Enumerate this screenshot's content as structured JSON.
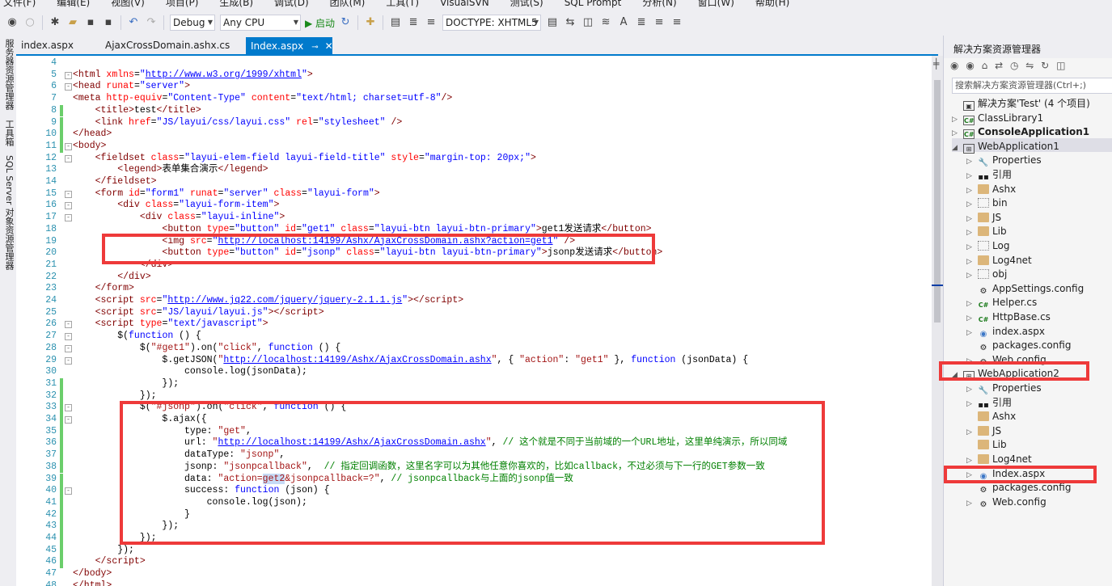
{
  "menu": [
    "文件(F)",
    "编辑(E)",
    "视图(V)",
    "项目(P)",
    "生成(B)",
    "调试(D)",
    "团队(M)",
    "工具(T)",
    "VisualSVN",
    "测试(S)",
    "SQL Prompt",
    "分析(N)",
    "窗口(W)",
    "帮助(H)"
  ],
  "toolbar": {
    "config": "Debug",
    "platform": "Any CPU",
    "start_label": "▶ 启动",
    "doctype": "DOCTYPE: XHTML5"
  },
  "left_tabs": [
    "服务器资源管理器",
    "工具箱",
    "SQL Server 对象资源管理器"
  ],
  "tabs": [
    {
      "label": "index.aspx"
    },
    {
      "label": "AjaxCrossDomain.ashx.cs"
    },
    {
      "label": "Index.aspx",
      "active": true,
      "pin": "⊸",
      "close": "✕"
    }
  ],
  "code": [
    {
      "n": "4",
      "bar": "none",
      "fold": "",
      "html": ""
    },
    {
      "n": "5",
      "bar": "none",
      "fold": "-",
      "html": "<span class='tag'>&lt;html</span> <span class='attr'>xmlns</span><span class='plain'>=</span><span class='val'>\"</span><span class='link'>http://www.w3.org/1999/xhtml</span><span class='val'>\"</span><span class='tag'>&gt;</span>"
    },
    {
      "n": "6",
      "bar": "none",
      "fold": "-",
      "html": "<span class='tag'>&lt;head</span> <span class='attr'>runat</span><span class='plain'>=</span><span class='val'>\"server\"</span><span class='tag'>&gt;</span>"
    },
    {
      "n": "7",
      "bar": "none",
      "fold": "",
      "html": "<span class='tag'>&lt;meta</span> <span class='attr'>http-equiv</span><span class='plain'>=</span><span class='val'>\"Content-Type\"</span> <span class='attr'>content</span><span class='plain'>=</span><span class='val'>\"text/html; charset=utf-8\"</span><span class='tag'>/&gt;</span>"
    },
    {
      "n": "8",
      "bar": "green",
      "fold": "",
      "html": "    <span class='tag'>&lt;title&gt;</span><span class='plain'>test</span><span class='tag'>&lt;/title&gt;</span>"
    },
    {
      "n": "9",
      "bar": "green",
      "fold": "",
      "html": "    <span class='tag'>&lt;link</span> <span class='attr'>href</span><span class='plain'>=</span><span class='val'>\"JS/layui/css/layui.css\"</span> <span class='attr'>rel</span><span class='plain'>=</span><span class='val'>\"stylesheet\"</span> <span class='tag'>/&gt;</span>"
    },
    {
      "n": "10",
      "bar": "green",
      "fold": "",
      "html": "<span class='tag'>&lt;/head&gt;</span>"
    },
    {
      "n": "11",
      "bar": "green",
      "fold": "-",
      "html": "<span class='tag'>&lt;body&gt;</span>"
    },
    {
      "n": "12",
      "bar": "none",
      "fold": "-",
      "html": "    <span class='tag'>&lt;fieldset</span> <span class='attr'>class</span><span class='plain'>=</span><span class='val'>\"layui-elem-field layui-field-title\"</span> <span class='attr'>style</span><span class='plain'>=</span><span class='val'>\"margin-top: 20px;\"</span><span class='tag'>&gt;</span>"
    },
    {
      "n": "13",
      "bar": "none",
      "fold": "",
      "html": "        <span class='tag'>&lt;legend&gt;</span><span class='plain'>表单集合演示</span><span class='tag'>&lt;/legend&gt;</span>"
    },
    {
      "n": "14",
      "bar": "none",
      "fold": "",
      "html": "    <span class='tag'>&lt;/fieldset&gt;</span>"
    },
    {
      "n": "15",
      "bar": "none",
      "fold": "-",
      "html": "    <span class='tag'>&lt;form</span> <span class='attr'>id</span><span class='plain'>=</span><span class='val'>\"form1\"</span> <span class='attr'>runat</span><span class='plain'>=</span><span class='val'>\"server\"</span> <span class='attr'>class</span><span class='plain'>=</span><span class='val'>\"layui-form\"</span><span class='tag'>&gt;</span>"
    },
    {
      "n": "16",
      "bar": "none",
      "fold": "-",
      "html": "        <span class='tag'>&lt;div</span> <span class='attr'>class</span><span class='plain'>=</span><span class='val'>\"layui-form-item\"</span><span class='tag'>&gt;</span>"
    },
    {
      "n": "17",
      "bar": "none",
      "fold": "-",
      "html": "            <span class='tag'>&lt;div</span> <span class='attr'>class</span><span class='plain'>=</span><span class='val'>\"layui-inline\"</span><span class='tag'>&gt;</span>"
    },
    {
      "n": "18",
      "bar": "none",
      "fold": "",
      "html": "                <span class='tag'>&lt;button</span> <span class='attr'>type</span><span class='plain'>=</span><span class='val'>\"button\"</span> <span class='attr'>id</span><span class='plain'>=</span><span class='val'>\"get1\"</span> <span class='attr'>class</span><span class='plain'>=</span><span class='val'>\"layui-btn layui-btn-primary\"</span><span class='tag'>&gt;</span><span class='plain'>get1发送请求</span><span class='tag'>&lt;/button&gt;</span>"
    },
    {
      "n": "19",
      "bar": "none",
      "fold": "",
      "html": "                <span class='tag'>&lt;img</span> <span class='attr'>src</span><span class='plain'>=</span><span class='val'>\"</span><span class='link'>http://localhost:14199/Ashx/AjaxCrossDomain.ashx?action=get1</span><span class='val'>\"</span> <span class='tag'>/&gt;</span>"
    },
    {
      "n": "20",
      "bar": "none",
      "fold": "",
      "html": "                <span class='tag'>&lt;button</span> <span class='attr'>type</span><span class='plain'>=</span><span class='val'>\"button\"</span> <span class='attr'>id</span><span class='plain'>=</span><span class='val'>\"jsonp\"</span> <span class='attr'>class</span><span class='plain'>=</span><span class='val'>\"layui-btn layui-btn-primary\"</span><span class='tag'>&gt;</span><span class='plain'>jsonp发送请求</span><span class='tag'>&lt;/button&gt;</span>"
    },
    {
      "n": "21",
      "bar": "none",
      "fold": "",
      "html": "            <span class='tag'>&lt;/div&gt;</span>"
    },
    {
      "n": "22",
      "bar": "none",
      "fold": "",
      "html": "        <span class='tag'>&lt;/div&gt;</span>"
    },
    {
      "n": "23",
      "bar": "none",
      "fold": "",
      "html": "    <span class='tag'>&lt;/form&gt;</span>"
    },
    {
      "n": "24",
      "bar": "none",
      "fold": "",
      "html": "    <span class='tag'>&lt;script</span> <span class='attr'>src</span><span class='plain'>=</span><span class='val'>\"</span><span class='link'>http://www.jq22.com/jquery/jquery-2.1.1.js</span><span class='val'>\"</span><span class='tag'>&gt;&lt;/script&gt;</span>"
    },
    {
      "n": "25",
      "bar": "none",
      "fold": "",
      "html": "    <span class='tag'>&lt;script</span> <span class='attr'>src</span><span class='plain'>=</span><span class='val'>\"JS/layui/layui.js\"</span><span class='tag'>&gt;&lt;/script&gt;</span>"
    },
    {
      "n": "26",
      "bar": "none",
      "fold": "-",
      "html": "    <span class='tag'>&lt;script</span> <span class='attr'>type</span><span class='plain'>=</span><span class='val'>\"text/javascript\"</span><span class='tag'>&gt;</span>"
    },
    {
      "n": "27",
      "bar": "none",
      "fold": "-",
      "html": "        <span class='plain'>$(</span><span class='kw'>function</span><span class='plain'> () {</span>"
    },
    {
      "n": "28",
      "bar": "none",
      "fold": "-",
      "html": "            <span class='plain'>$(</span><span class='str'>\"#get1\"</span><span class='plain'>).on(</span><span class='str'>\"click\"</span><span class='plain'>, </span><span class='kw'>function</span><span class='plain'> () {</span>"
    },
    {
      "n": "29",
      "bar": "none",
      "fold": "-",
      "html": "                <span class='plain'>$.getJSON(</span><span class='str'>\"</span><span class='link'>http://localhost:14199/Ashx/AjaxCrossDomain.ashx</span><span class='str'>\"</span><span class='plain'>, { </span><span class='str'>\"action\"</span><span class='plain'>: </span><span class='str'>\"get1\"</span><span class='plain'> }, </span><span class='kw'>function</span><span class='plain'> (jsonData) {</span>"
    },
    {
      "n": "30",
      "bar": "none",
      "fold": "",
      "html": "                    <span class='plain'>console.log(jsonData);</span>"
    },
    {
      "n": "31",
      "bar": "green",
      "fold": "",
      "html": "                <span class='plain'>});</span>"
    },
    {
      "n": "32",
      "bar": "green",
      "fold": "",
      "html": "            <span class='plain'>});</span>"
    },
    {
      "n": "33",
      "bar": "green",
      "fold": "-",
      "html": "            <span class='plain'>$(</span><span class='str'>\"#jsonp\"</span><span class='plain'>).on(</span><span class='str'>\"click\"</span><span class='plain'>, </span><span class='kw'>function</span><span class='plain'> () {</span>"
    },
    {
      "n": "34",
      "bar": "green",
      "fold": "-",
      "html": "                <span class='plain'>$.ajax({</span>"
    },
    {
      "n": "35",
      "bar": "green",
      "fold": "",
      "html": "                    <span class='plain'>type: </span><span class='str'>\"get\"</span><span class='plain'>,</span>"
    },
    {
      "n": "36",
      "bar": "green",
      "fold": "",
      "html": "                    <span class='plain'>url: </span><span class='str'>\"</span><span class='link'>http://localhost:14199/Ashx/AjaxCrossDomain.ashx</span><span class='str'>\"</span><span class='plain'>, </span><span class='cm'>// 这个就是不同于当前域的一个URL地址，这里单纯演示，所以同域</span>"
    },
    {
      "n": "37",
      "bar": "green",
      "fold": "",
      "html": "                    <span class='plain'>dataType: </span><span class='str'>\"jsonp\"</span><span class='plain'>,</span>"
    },
    {
      "n": "38",
      "bar": "green",
      "fold": "",
      "html": "                    <span class='plain'>jsonp: </span><span class='str'>\"jsonpcallback\"</span><span class='plain'>,  </span><span class='cm'>// 指定回调函数，这里名字可以为其他任意你喜欢的，比如callback，不过必须与下一行的GET参数一致</span>"
    },
    {
      "n": "39",
      "bar": "green",
      "fold": "",
      "html": "                    <span class='plain'>data: </span><span class='str'>\"action=</span><span class='str' style='background:#c6dbf6'>get2</span><span class='str'>&amp;jsonpcallback=?\"</span><span class='plain'>, </span><span class='cm'>// jsonpcallback与上面的jsonp值一致</span>"
    },
    {
      "n": "40",
      "bar": "green",
      "fold": "-",
      "html": "                    <span class='plain'>success: </span><span class='kw'>function</span><span class='plain'> (json) {</span>"
    },
    {
      "n": "41",
      "bar": "green",
      "fold": "",
      "html": "                        <span class='plain'>console.log(json);</span>"
    },
    {
      "n": "42",
      "bar": "green",
      "fold": "",
      "html": "                    <span class='plain'>}</span>"
    },
    {
      "n": "43",
      "bar": "green",
      "fold": "",
      "html": "                <span class='plain'>});</span>"
    },
    {
      "n": "44",
      "bar": "green",
      "fold": "",
      "html": "            <span class='plain'>});</span>"
    },
    {
      "n": "45",
      "bar": "green",
      "fold": "",
      "html": "        <span class='plain'>});</span>"
    },
    {
      "n": "46",
      "bar": "green",
      "fold": "",
      "html": "    <span class='tag'>&lt;/script&gt;</span>"
    },
    {
      "n": "47",
      "bar": "none",
      "fold": "",
      "html": "<span class='tag'>&lt;/body&gt;</span>"
    },
    {
      "n": "48",
      "bar": "none",
      "fold": "",
      "html": "<span class='tag'>&lt;/html&gt;</span>"
    }
  ],
  "solution_explorer": {
    "title": "解决方案资源管理器",
    "search_placeholder": "搜索解决方案资源管理器(Ctrl+;)",
    "items": [
      {
        "label": "解决方案'Test' (4 个项目)",
        "depth": 0,
        "exp": "",
        "icon": "sol"
      },
      {
        "label": "ClassLibrary1",
        "depth": 0,
        "exp": "▷",
        "icon": "cs"
      },
      {
        "label": "ConsoleApplication1",
        "depth": 0,
        "exp": "▷",
        "icon": "cs",
        "bold": true
      },
      {
        "label": "WebApplication1",
        "depth": 0,
        "exp": "◢",
        "icon": "web-proj"
      },
      {
        "label": "Properties",
        "depth": 1,
        "exp": "▷",
        "icon": "wrench"
      },
      {
        "label": "引用",
        "depth": 1,
        "exp": "▷",
        "icon": "ref"
      },
      {
        "label": "Ashx",
        "depth": 1,
        "exp": "▷",
        "icon": "folder"
      },
      {
        "label": "bin",
        "depth": 1,
        "exp": "▷",
        "icon": "dotted"
      },
      {
        "label": "JS",
        "depth": 1,
        "exp": "▷",
        "icon": "folder"
      },
      {
        "label": "Lib",
        "depth": 1,
        "exp": "▷",
        "icon": "folder"
      },
      {
        "label": "Log",
        "depth": 1,
        "exp": "▷",
        "icon": "dotted"
      },
      {
        "label": "Log4net",
        "depth": 1,
        "exp": "▷",
        "icon": "folder"
      },
      {
        "label": "obj",
        "depth": 1,
        "exp": "▷",
        "icon": "dotted"
      },
      {
        "label": "AppSettings.config",
        "depth": 1,
        "exp": "",
        "icon": "config"
      },
      {
        "label": "Helper.cs",
        "depth": 1,
        "exp": "▷",
        "icon": "csfile"
      },
      {
        "label": "HttpBase.cs",
        "depth": 1,
        "exp": "▷",
        "icon": "csfile"
      },
      {
        "label": "index.aspx",
        "depth": 1,
        "exp": "▷",
        "icon": "web"
      },
      {
        "label": "packages.config",
        "depth": 1,
        "exp": "",
        "icon": "config"
      },
      {
        "label": "Web.config",
        "depth": 1,
        "exp": "▷",
        "icon": "config"
      },
      {
        "label": "WebApplication2",
        "depth": 0,
        "exp": "◢",
        "icon": "web-proj"
      },
      {
        "label": "Properties",
        "depth": 1,
        "exp": "▷",
        "icon": "wrench"
      },
      {
        "label": "引用",
        "depth": 1,
        "exp": "▷",
        "icon": "ref"
      },
      {
        "label": "Ashx",
        "depth": 1,
        "exp": "",
        "icon": "folder"
      },
      {
        "label": "JS",
        "depth": 1,
        "exp": "▷",
        "icon": "folder"
      },
      {
        "label": "Lib",
        "depth": 1,
        "exp": "",
        "icon": "folder"
      },
      {
        "label": "Log4net",
        "depth": 1,
        "exp": "▷",
        "icon": "folder"
      },
      {
        "label": "Index.aspx",
        "depth": 1,
        "exp": "▷",
        "icon": "web"
      },
      {
        "label": "packages.config",
        "depth": 1,
        "exp": "",
        "icon": "config"
      },
      {
        "label": "Web.config",
        "depth": 1,
        "exp": "▷",
        "icon": "config"
      }
    ]
  },
  "colors": {
    "accent": "#007acc",
    "highlight_box": "#ee3a3a",
    "change_bar": "#6bce6b"
  }
}
